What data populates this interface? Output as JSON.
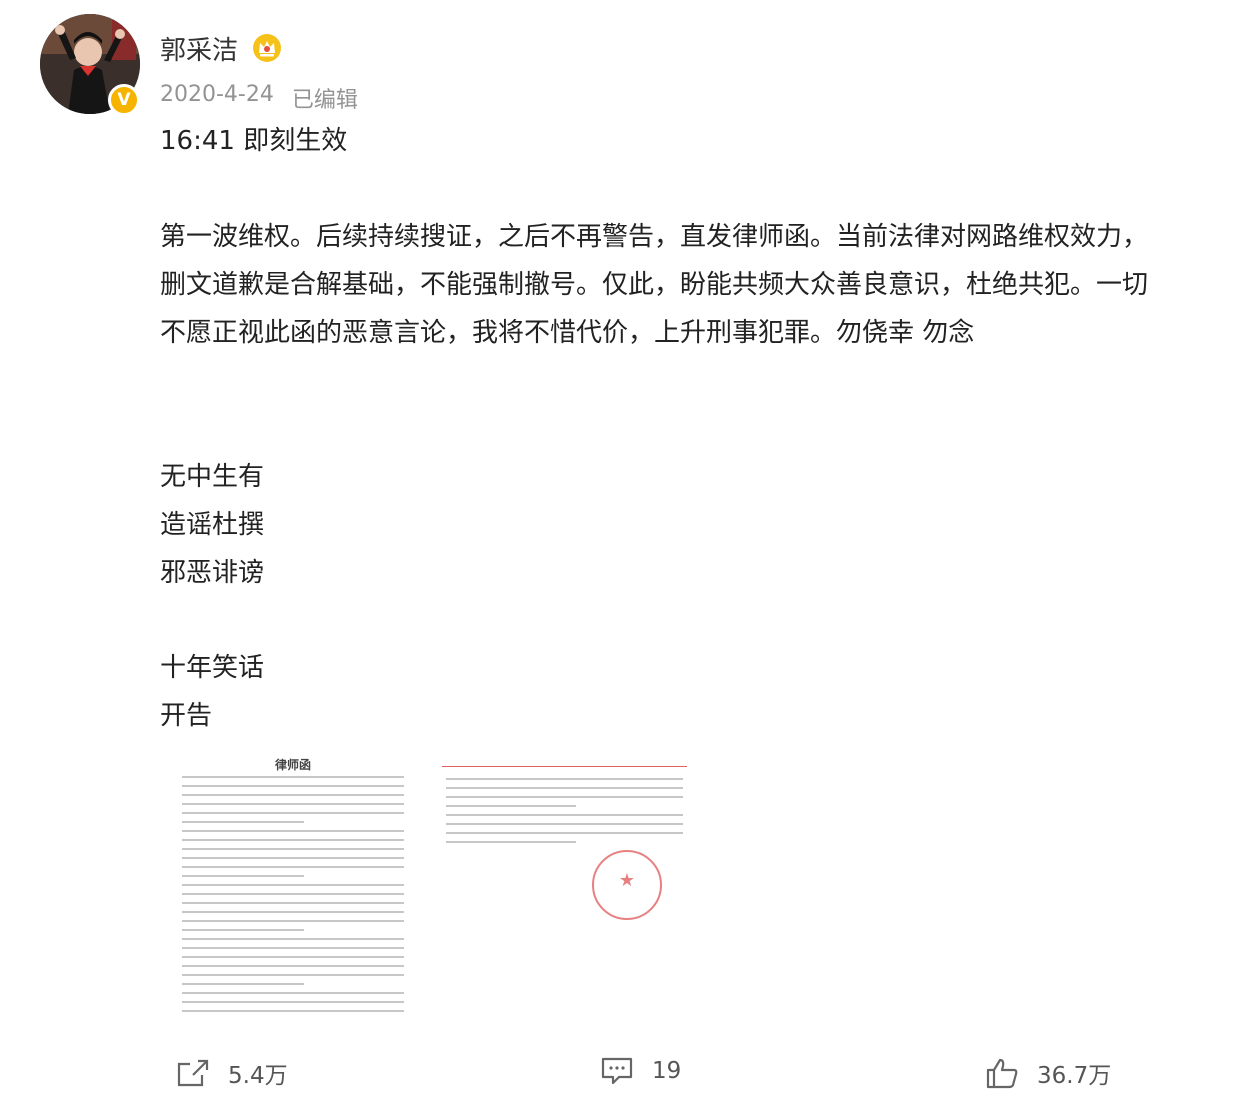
{
  "user": {
    "name": "郭采洁",
    "verified_mark": "V",
    "avatar_icon": "avatar-photo",
    "badge_icon": "crown-icon"
  },
  "post": {
    "date": "2020-4-24",
    "edited": "已编辑",
    "time_line": "16:41 即刻生效",
    "paragraph_lines": [
      "第一波维权。后续持续搜证，之后不再警告，直发律师函。当前法律对网路维权效力，",
      "删文道歉是合解基础，不能强制撤号。仅此，盼能共频大众善良意识，杜绝共犯。一切",
      "不愿正视此函的恶意言论，我将不惜代价，上升刑事犯罪。勿侥幸 勿念"
    ],
    "list_a": [
      "无中生有",
      "造谣杜撰",
      "邪恶诽谤"
    ],
    "list_b": [
      "十年笑话",
      "开告"
    ],
    "attachments": [
      {
        "title": "律师函"
      },
      {
        "title": ""
      }
    ]
  },
  "actions": {
    "repost_count": "5.4万",
    "comment_count": "19",
    "like_count": "36.7万"
  },
  "colors": {
    "text": "#222222",
    "meta": "#939393",
    "vip_gold": "#f6b400",
    "seal_red": "#e36b6b"
  }
}
